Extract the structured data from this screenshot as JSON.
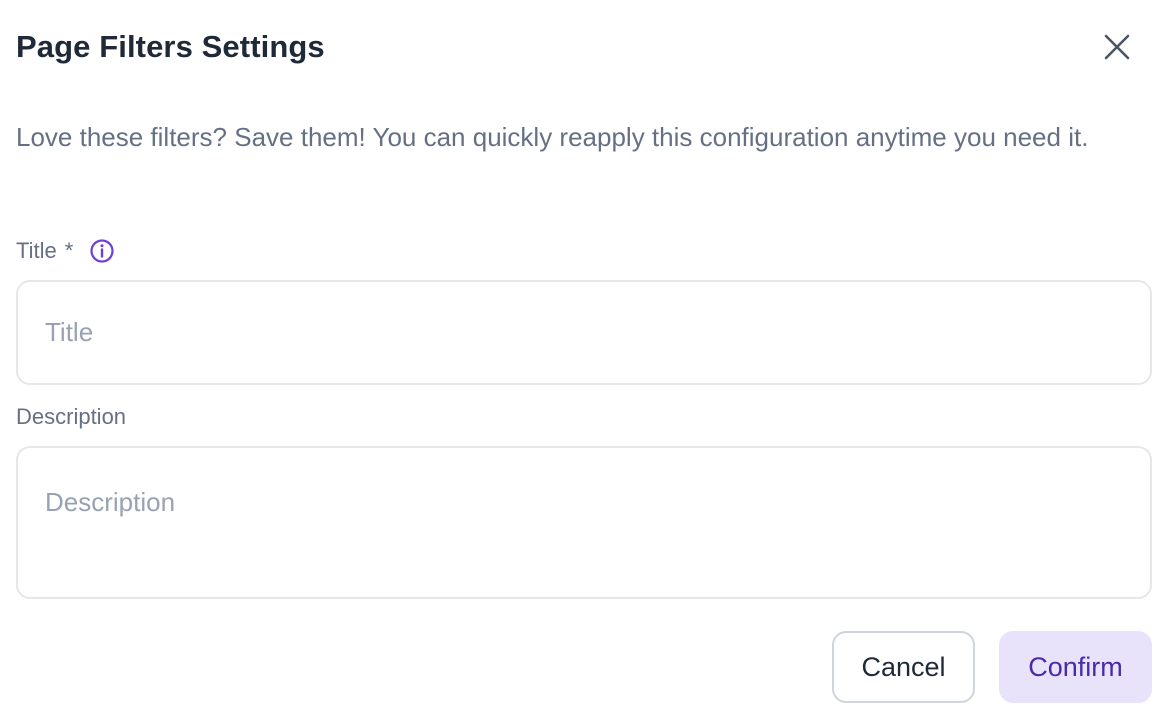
{
  "dialog": {
    "title": "Page Filters Settings",
    "close_icon": "close-icon",
    "intro_text": "Love these filters? Save them! You can quickly reapply this configuration anytime you need it."
  },
  "form": {
    "title_field": {
      "label": "Title",
      "required_mark": "*",
      "info_icon": "info-icon",
      "value": "",
      "placeholder": "Title"
    },
    "description_field": {
      "label": "Description",
      "value": "",
      "placeholder": "Description"
    }
  },
  "actions": {
    "cancel_label": "Cancel",
    "confirm_label": "Confirm"
  },
  "colors": {
    "accent": "#6d3fd6",
    "confirm_bg": "#e9e2fb",
    "confirm_text": "#4a2aa8",
    "muted_text": "#667085",
    "placeholder": "#98a2b3",
    "border": "#e5e7eb"
  }
}
